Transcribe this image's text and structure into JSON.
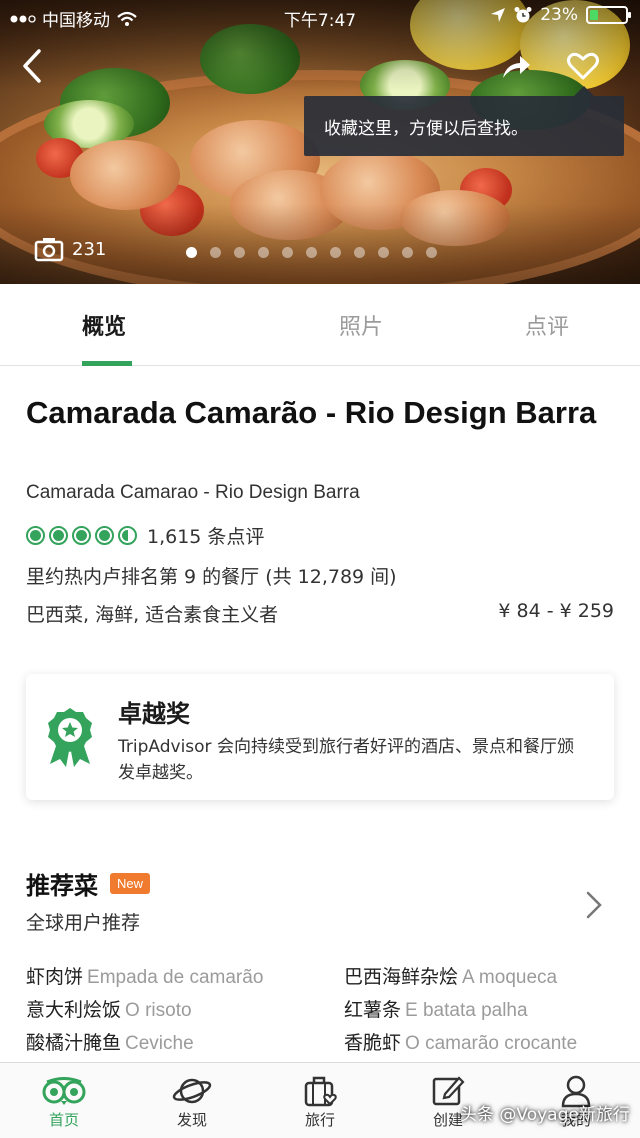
{
  "status_bar": {
    "carrier": "中国移动",
    "time": "下午7:47",
    "battery": "23%",
    "battery_level": 0.23
  },
  "hero": {
    "photo_count": "231",
    "tooltip": "收藏这里，方便以后查找。",
    "slide_count": 11,
    "active_slide": 0,
    "icons": {
      "back": "back-arrow-icon",
      "share": "share-icon",
      "favorite": "heart-icon",
      "camera": "camera-icon"
    }
  },
  "tabs": [
    {
      "label": "概览",
      "active": true
    },
    {
      "label": "照片",
      "active": false
    },
    {
      "label": "点评",
      "active": false
    }
  ],
  "restaurant": {
    "name": "Camarada Camarão - Rio Design Barra",
    "alt_name": "Camarada Camarao - Rio Design Barra",
    "rating": 4.5,
    "reviews": "1,615 条点评",
    "ranking": "里约热内卢排名第 9 的餐厅 (共 12,789 间)",
    "cuisine": "巴西菜, 海鲜, 适合素食主义者",
    "price": "¥ 84 - ¥ 259"
  },
  "award": {
    "title": "卓越奖",
    "description": "TripAdvisor 会向持续受到旅行者好评的酒店、景点和餐厅颁发卓越奖。"
  },
  "recommended": {
    "title": "推荐菜",
    "badge": "New",
    "subtitle": "全球用户推荐",
    "dishes": [
      {
        "zh": "虾肉饼",
        "en": "Empada de camarão"
      },
      {
        "zh": "巴西海鲜杂烩",
        "en": "A moqueca"
      },
      {
        "zh": "意大利烩饭",
        "en": "O risoto"
      },
      {
        "zh": "红薯条",
        "en": "E batata palha"
      },
      {
        "zh": "酸橘汁腌鱼",
        "en": "Ceviche"
      },
      {
        "zh": "香脆虾",
        "en": "O camarão crocante"
      }
    ]
  },
  "bottom_nav": [
    {
      "label": "首页",
      "icon": "owl-logo-icon",
      "active": true
    },
    {
      "label": "发现",
      "icon": "planet-icon",
      "active": false
    },
    {
      "label": "旅行",
      "icon": "suitcase-heart-icon",
      "active": false
    },
    {
      "label": "创建",
      "icon": "edit-icon",
      "active": false
    },
    {
      "label": "我的",
      "icon": "profile-icon",
      "active": false
    }
  ],
  "watermark": "头条 @Voyage新旅行",
  "colors": {
    "accent": "#34a35c",
    "badge": "#f07a2e",
    "tooltip_bg": "#282e38"
  }
}
